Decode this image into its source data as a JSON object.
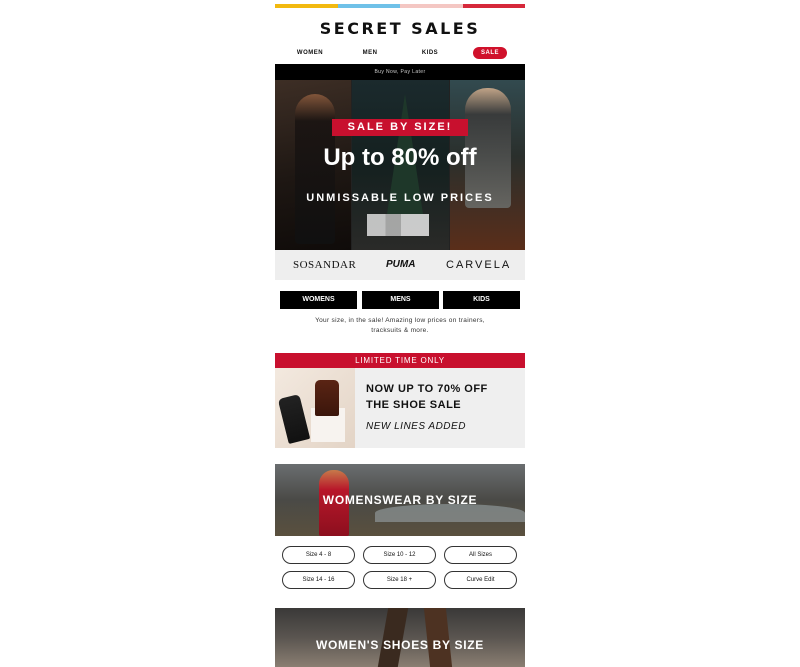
{
  "colors": {
    "accent_red": "#c8102e",
    "top_bar": [
      "#f2b90f",
      "#6fc1e8",
      "#f4c7c3",
      "#d6283a"
    ]
  },
  "brand": {
    "logo": "SECRET SALES"
  },
  "nav": {
    "women": "WOMEN",
    "men": "MEN",
    "kids": "KIDS",
    "sale": "SALE"
  },
  "hero": {
    "strip": "Buy Now, Pay Later",
    "sale_banner": "SALE BY SIZE!",
    "headline": "Up to 80% off",
    "subheadline": "UNMISSABLE LOW PRICES"
  },
  "brands": [
    "SOSANDAR",
    "PUMA",
    "CARVELA"
  ],
  "categories": {
    "womens": "WOMENS",
    "mens": "MENS",
    "kids": "KIDS"
  },
  "description": "Your size, in the sale! Amazing low prices on trainers, tracksuits & more.",
  "shoe_promo": {
    "label": "LIMITED TIME ONLY",
    "line1": "NOW UP TO 70% OFF",
    "line2": "THE SHOE SALE",
    "line3": "NEW LINES ADDED"
  },
  "womenswear": {
    "title": "WOMENSWEAR BY SIZE",
    "sizes": [
      "Size 4 - 8",
      "Size 10 - 12",
      "All Sizes",
      "Size 14 - 16",
      "Size 18 +",
      "Curve Edit"
    ]
  },
  "womens_shoes": {
    "title": "WOMEN'S SHOES BY SIZE"
  }
}
